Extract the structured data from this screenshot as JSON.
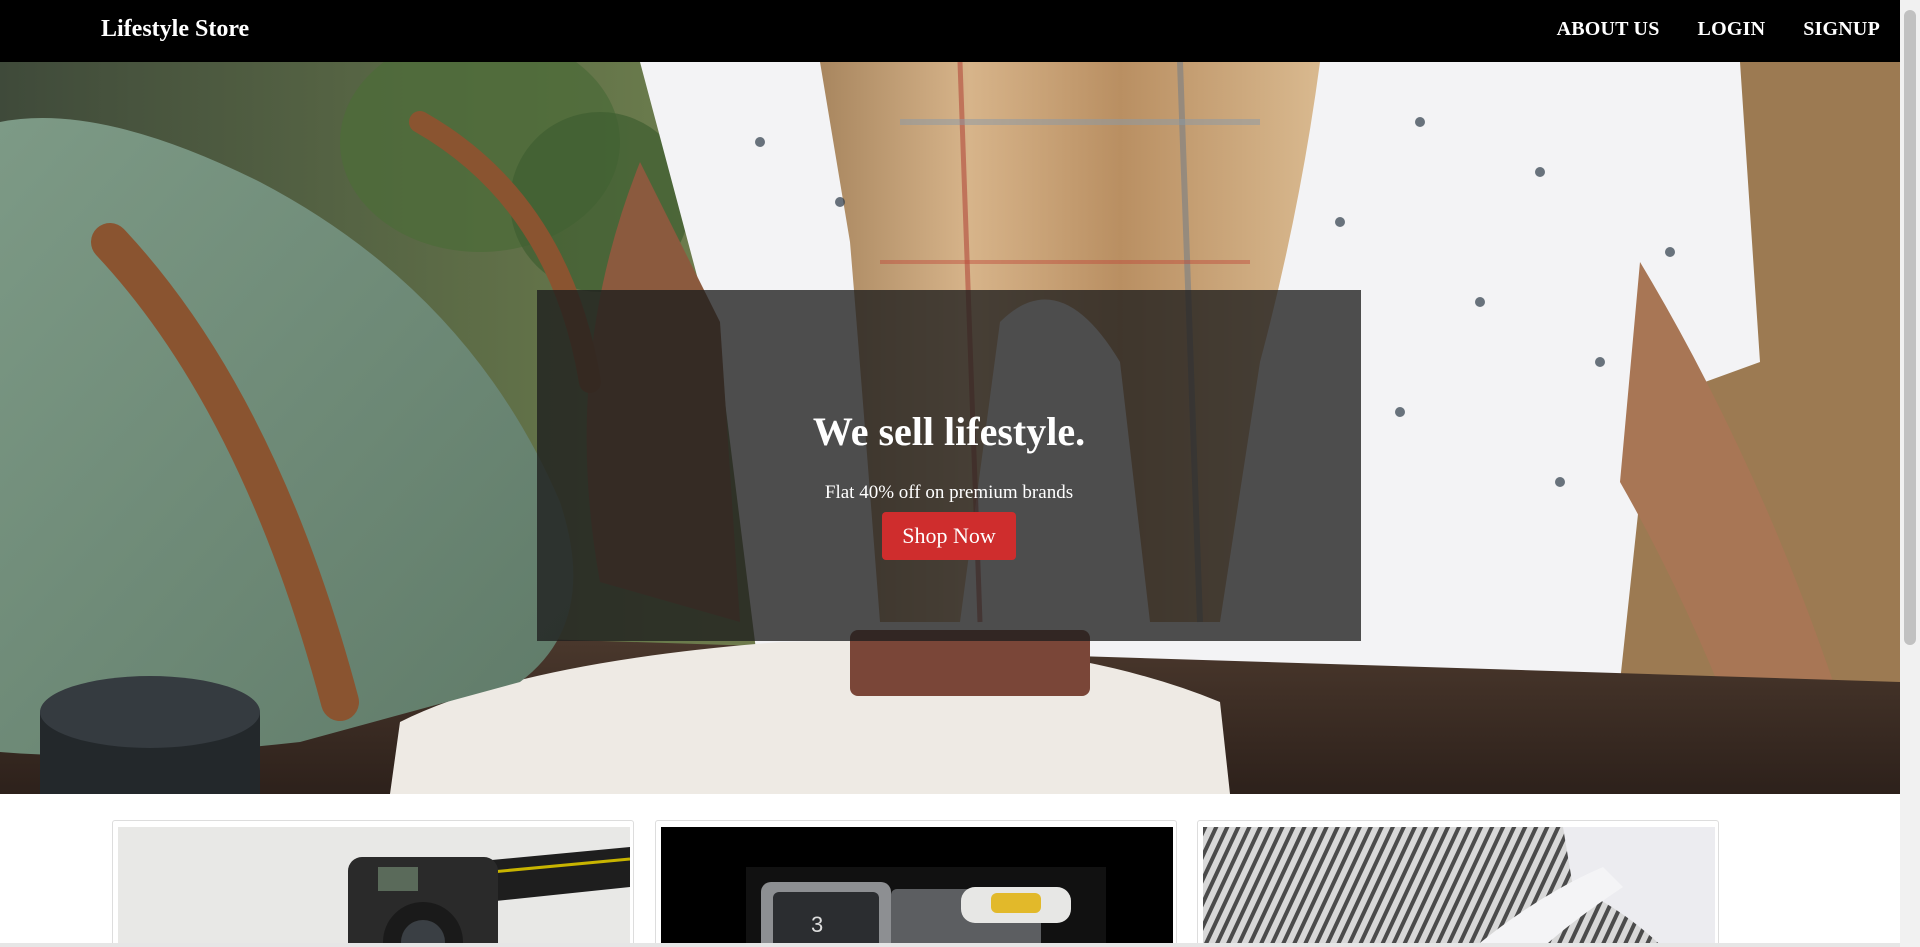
{
  "navbar": {
    "brand": "Lifestyle Store",
    "links": [
      {
        "label": "ABOUT US"
      },
      {
        "label": "LOGIN"
      },
      {
        "label": "SIGNUP"
      }
    ]
  },
  "hero": {
    "title": "We sell lifestyle.",
    "subtitle": "Flat 40% off on premium brands",
    "cta_label": "Shop Now"
  },
  "products": [
    {
      "image": "camera-photo"
    },
    {
      "image": "watch-photo"
    },
    {
      "image": "striped-shirt-photo"
    }
  ],
  "colors": {
    "navbar_bg": "#000000",
    "cta_bg": "#cf2d2d",
    "hero_overlay": "rgba(30,30,30,0.78)"
  }
}
